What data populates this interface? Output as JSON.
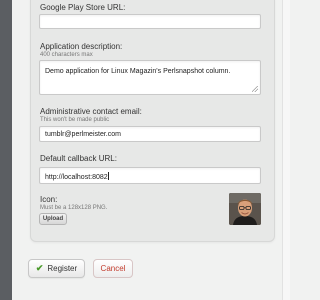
{
  "form": {
    "play_store": {
      "label": "Google Play Store URL:",
      "value": ""
    },
    "description": {
      "label": "Application description:",
      "hint": "400 characters max",
      "value": "Demo application for Linux Magazin's Perlsnapshot column."
    },
    "admin_email": {
      "label": "Administrative contact email:",
      "hint": "This won't be made public",
      "value": "tumblr@perlmeister.com"
    },
    "callback_url": {
      "label": "Default callback URL:",
      "value": "http://localhost:8082"
    },
    "icon": {
      "label": "Icon:",
      "hint": "Must be a 128x128 PNG.",
      "upload_label": "Upload"
    }
  },
  "actions": {
    "register_label": "Register",
    "cancel_label": "Cancel"
  },
  "icons": {
    "register": "checkmark-icon",
    "icon_preview": "user-avatar-photo"
  },
  "colors": {
    "checkmark": "#4a9a2a",
    "cancel_text": "#c23b2c",
    "panel_background": "#e7e8e7",
    "page_background": "#f1f2f1",
    "left_edge": "#5b5e62"
  }
}
